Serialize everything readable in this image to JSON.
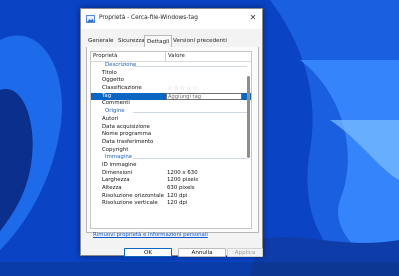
{
  "window": {
    "title": "Proprietà - Cerca-file-Windows-tag",
    "close": "✕"
  },
  "tabs": [
    {
      "label": "Generale"
    },
    {
      "label": "Sicurezza"
    },
    {
      "label": "Dettagli",
      "active": true
    },
    {
      "label": "Versioni precedenti"
    }
  ],
  "grid": {
    "col_property": "Proprietà",
    "col_value": "Valore"
  },
  "rows": [
    {
      "type": "section",
      "label": "Descrizione"
    },
    {
      "key": "Titolo",
      "value": ""
    },
    {
      "key": "Oggetto",
      "value": ""
    },
    {
      "key": "Classificazione",
      "value": "☆☆☆☆☆"
    },
    {
      "key": "Tag",
      "value": "Aggiungi tag",
      "selected": true
    },
    {
      "key": "Commenti",
      "value": ""
    },
    {
      "type": "section",
      "label": "Origine"
    },
    {
      "key": "Autori",
      "value": ""
    },
    {
      "key": "Data acquisizione",
      "value": ""
    },
    {
      "key": "Nome programma",
      "value": ""
    },
    {
      "key": "Data trasferimento",
      "value": ""
    },
    {
      "key": "Copyright",
      "value": ""
    },
    {
      "type": "section",
      "label": "Immagine"
    },
    {
      "key": "ID immagine",
      "value": ""
    },
    {
      "key": "Dimensioni",
      "value": "1200 x 630"
    },
    {
      "key": "Larghezza",
      "value": "1200 pixels"
    },
    {
      "key": "Altezza",
      "value": "630 pixels"
    },
    {
      "key": "Risoluzione orizzontale",
      "value": "120 dpi"
    },
    {
      "key": "Risoluzione verticale",
      "value": "120 dpi"
    }
  ],
  "footer": {
    "remove_link": "Rimuovi proprietà e informazioni personali",
    "ok": "OK",
    "cancel": "Annulla",
    "apply": "Applica"
  },
  "colors": {
    "accent": "#0a66c2",
    "section": "#1a5fb4",
    "wallpaper": "#0a3fb0"
  }
}
